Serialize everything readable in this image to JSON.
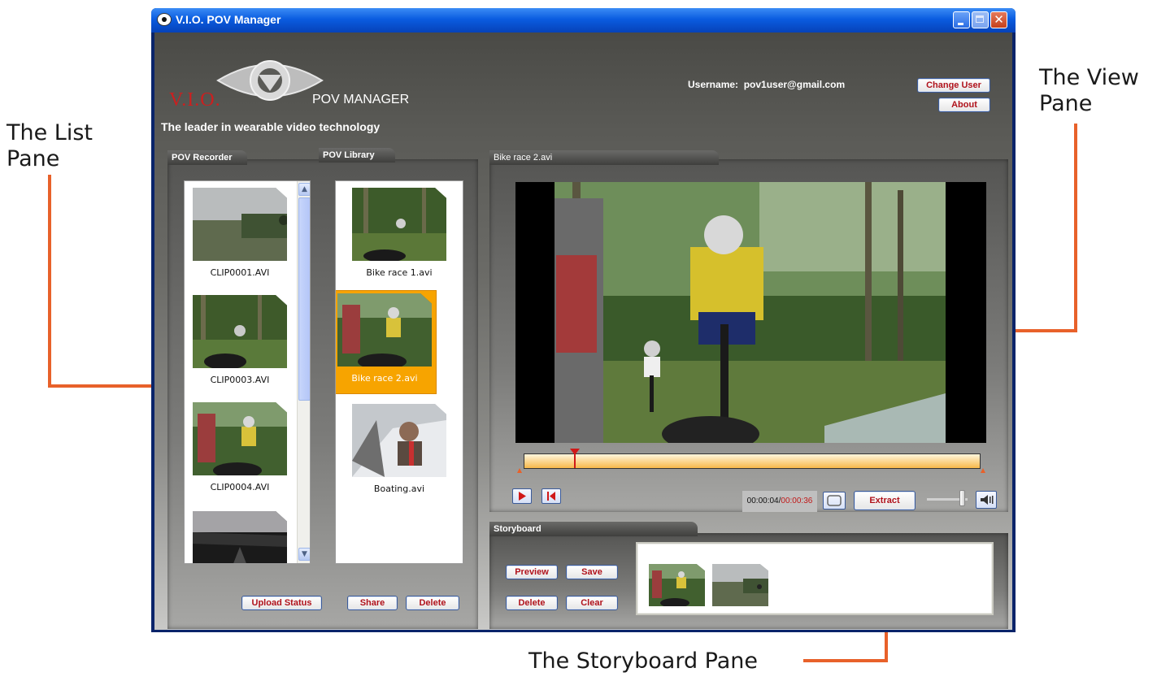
{
  "annotations": {
    "list_pane": [
      "The List",
      "Pane"
    ],
    "view_pane": [
      "The View",
      "Pane"
    ],
    "storyboard_pane": "The Storyboard Pane"
  },
  "window": {
    "title": "V.I.O. POV Manager",
    "close_glyph": "✕"
  },
  "header": {
    "logo_text": "V.I.O.",
    "product_name": "POV MANAGER",
    "tagline": "The leader in wearable video technology",
    "username_label": "Username:",
    "username": "pov1user@gmail.com",
    "change_user_label": "Change User",
    "about_label": "About"
  },
  "recorder": {
    "tab_label": "POV Recorder",
    "clips": [
      {
        "name": "CLIP0001.AVI"
      },
      {
        "name": "CLIP0003.AVI"
      },
      {
        "name": "CLIP0004.AVI"
      },
      {
        "name": ""
      }
    ],
    "scroll_up_glyph": "▲",
    "scroll_down_glyph": "▼"
  },
  "library": {
    "tab_label": "POV Library",
    "clips": [
      {
        "name": "Bike race 1.avi",
        "selected": false
      },
      {
        "name": "Bike race 2.avi",
        "selected": true
      },
      {
        "name": "Boating.avi",
        "selected": false
      }
    ]
  },
  "list_actions": {
    "upload_status_label": "Upload Status",
    "share_label": "Share",
    "delete_label": "Delete"
  },
  "view": {
    "tab_label": "Bike race 2.avi",
    "timeline_progress": 0.11,
    "current_time": "00:00:04/",
    "duration": "00:00:36",
    "extract_label": "Extract",
    "volume_level": 0.85
  },
  "storyboard": {
    "tab_label": "Storyboard",
    "preview_label": "Preview",
    "save_label": "Save",
    "delete_label": "Delete",
    "clear_label": "Clear"
  },
  "colors": {
    "accent_orange": "#f7a400",
    "annotation_line": "#e8612a",
    "button_text": "#b0121b",
    "title_bar": "#0a5ce0"
  }
}
